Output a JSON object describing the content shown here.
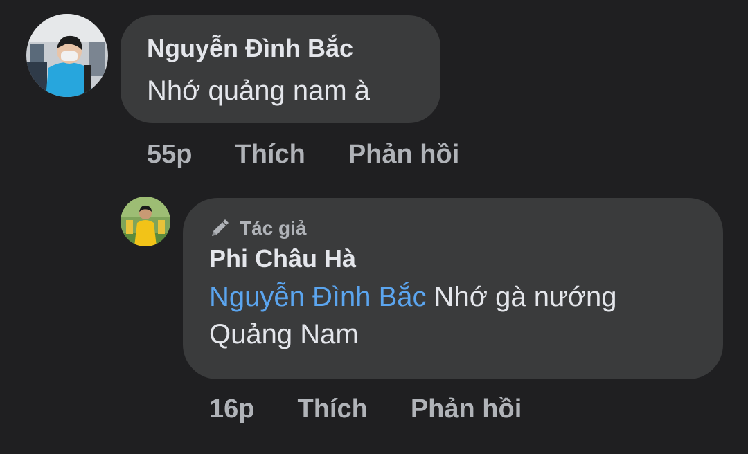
{
  "comments": [
    {
      "author": "Nguyễn Đình Bắc",
      "text": "Nhớ quảng nam à",
      "time": "55p",
      "like_label": "Thích",
      "reply_label": "Phản hồi"
    }
  ],
  "reply": {
    "badge": "Tác giả",
    "badge_icon": "pen-icon",
    "author": "Phi Châu Hà",
    "mention": "Nguyễn Đình Bắc",
    "text_line1": " Nhớ gà nướng",
    "text_line2": "Quảng Nam",
    "time": "16p",
    "like_label": "Thích",
    "reply_label": "Phản hồi"
  },
  "colors": {
    "background": "#1f1f21",
    "bubble": "#3a3b3c",
    "primary_text": "#e4e6eb",
    "secondary_text": "#b0b3b8",
    "mention": "#5ba5ef"
  }
}
